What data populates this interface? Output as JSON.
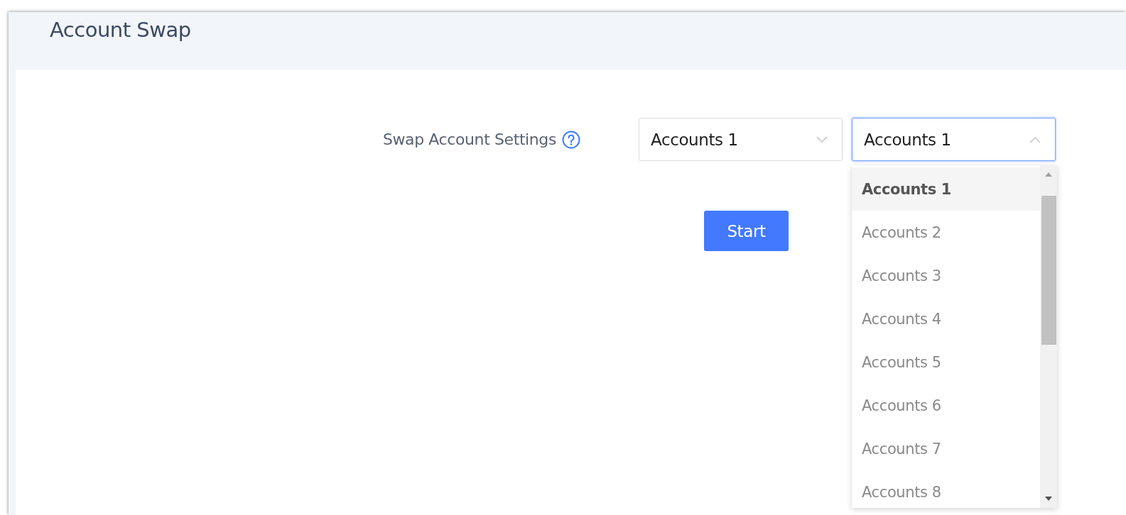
{
  "title": "Account Swap",
  "form": {
    "label": "Swap Account Settings",
    "selects": [
      {
        "value": "Accounts 1",
        "expanded": false
      },
      {
        "value": "Accounts 1",
        "expanded": true
      }
    ],
    "options": [
      {
        "label": "Accounts 1",
        "selected": true
      },
      {
        "label": "Accounts 2",
        "selected": false
      },
      {
        "label": "Accounts 3",
        "selected": false
      },
      {
        "label": "Accounts 4",
        "selected": false
      },
      {
        "label": "Accounts 5",
        "selected": false
      },
      {
        "label": "Accounts 6",
        "selected": false
      },
      {
        "label": "Accounts 7",
        "selected": false
      },
      {
        "label": "Accounts 8",
        "selected": false
      }
    ],
    "button": "Start"
  }
}
